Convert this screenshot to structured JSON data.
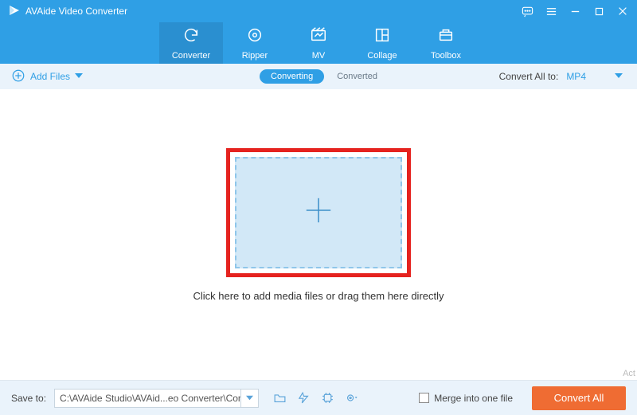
{
  "app": {
    "title": "AVAide Video Converter"
  },
  "nav": {
    "items": [
      {
        "label": "Converter"
      },
      {
        "label": "Ripper"
      },
      {
        "label": "MV"
      },
      {
        "label": "Collage"
      },
      {
        "label": "Toolbox"
      }
    ]
  },
  "toolbar": {
    "add_files_label": "Add Files",
    "tab_converting": "Converting",
    "tab_converted": "Converted",
    "convert_all_to_label": "Convert All to:",
    "target_format": "MP4"
  },
  "main": {
    "hint": "Click here to add media files or drag them here directly"
  },
  "footer": {
    "save_to_label": "Save to:",
    "save_path": "C:\\AVAide Studio\\AVAid...eo Converter\\Converted",
    "merge_label": "Merge into one file",
    "convert_button": "Convert All"
  },
  "misc": {
    "act": "Act"
  }
}
